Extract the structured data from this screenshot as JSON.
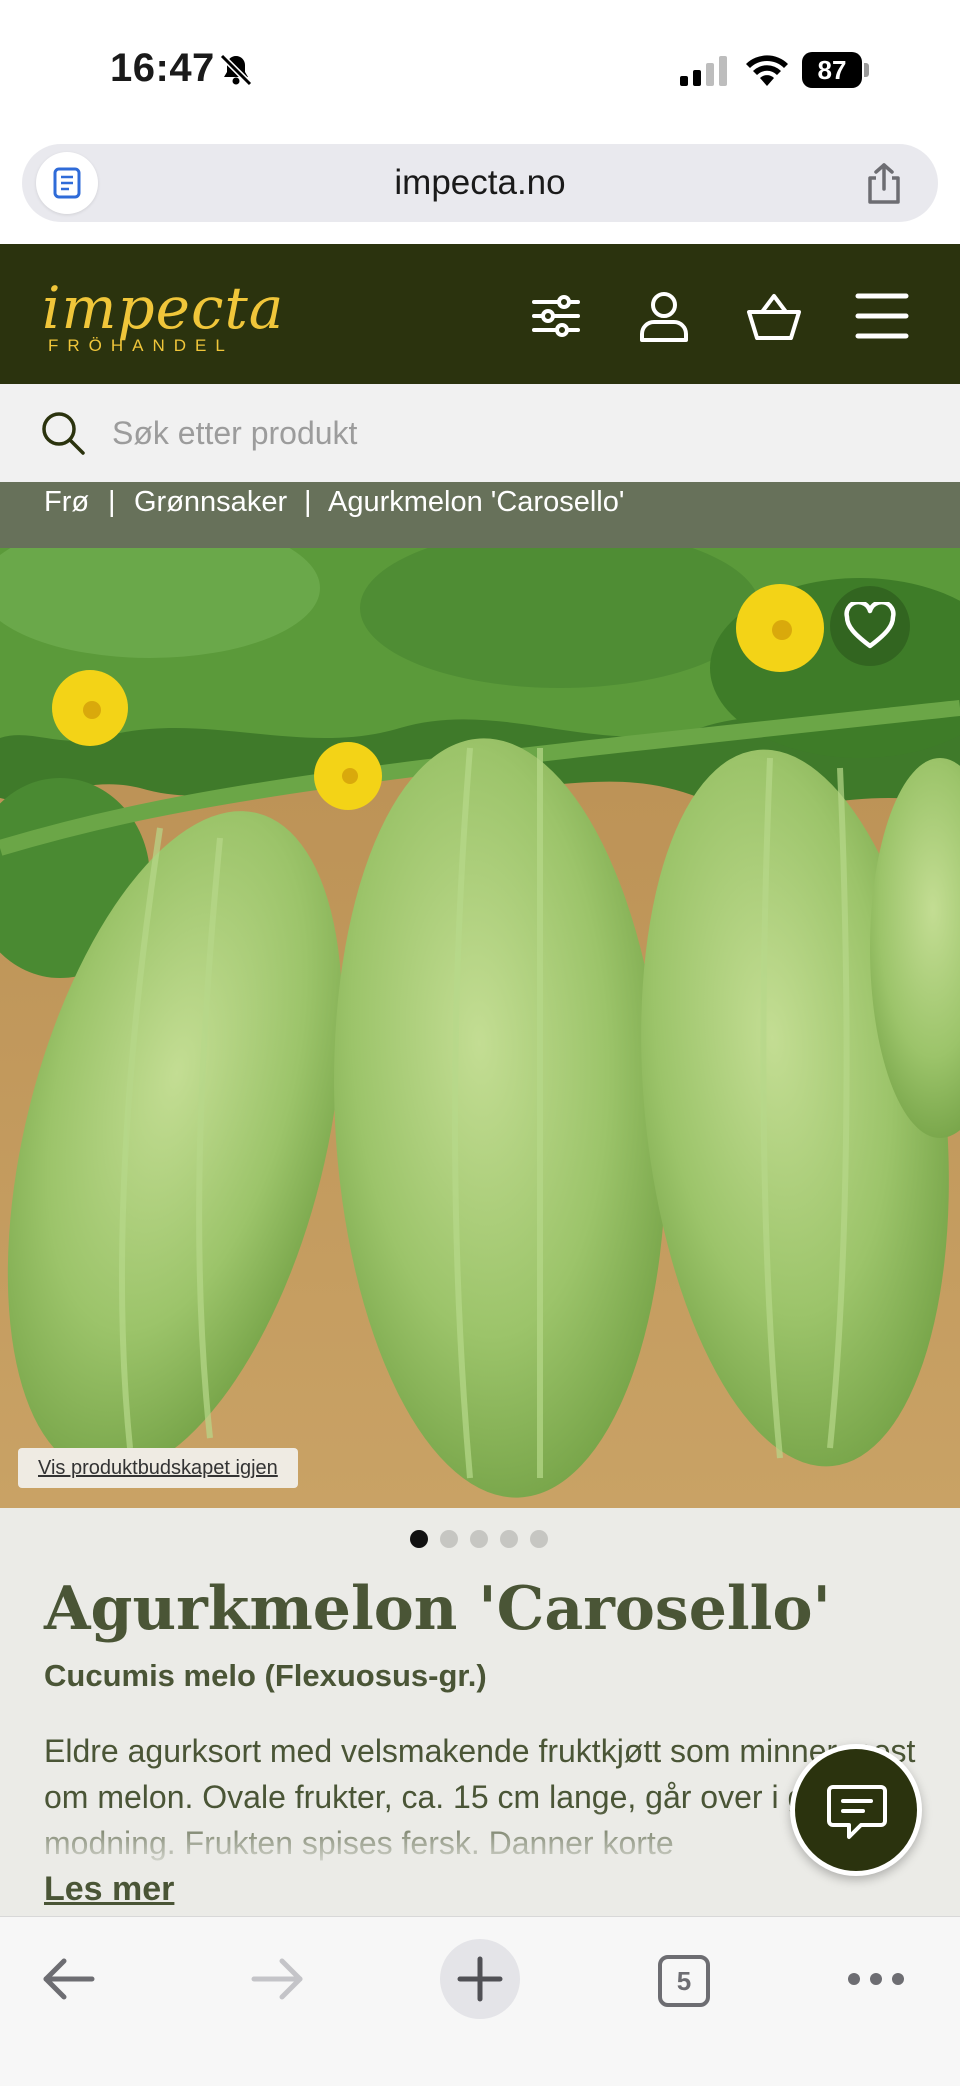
{
  "status_bar": {
    "time": "16:47",
    "battery_level": "87"
  },
  "browser": {
    "url": "impecta.no",
    "tabs_count": "5"
  },
  "site": {
    "logo_main": "impecta",
    "logo_sub": "FRÖHANDEL",
    "brand_color": "#2b330e",
    "logo_color": "#f0c63a"
  },
  "search": {
    "placeholder": "Søk etter produkt"
  },
  "breadcrumb": {
    "items": [
      "Frø",
      "Grønnsaker",
      "Agurkmelon 'Carosello'"
    ]
  },
  "hero": {
    "packet_link": "Vis produktbudskapet igjen",
    "image_count": 5,
    "active_image": 1
  },
  "product": {
    "title": "Agurkmelon 'Carosello'",
    "latin_name": "Cucumis melo (Flexuosus-gr.)",
    "description": "Eldre agurksort med velsmakende fruktkjøtt som minner mest om melon. Ovale frukter, ca. 15 cm lange, går over i gult ved modning. Frukten spises fersk. Danner korte",
    "read_more": "Les mer"
  }
}
